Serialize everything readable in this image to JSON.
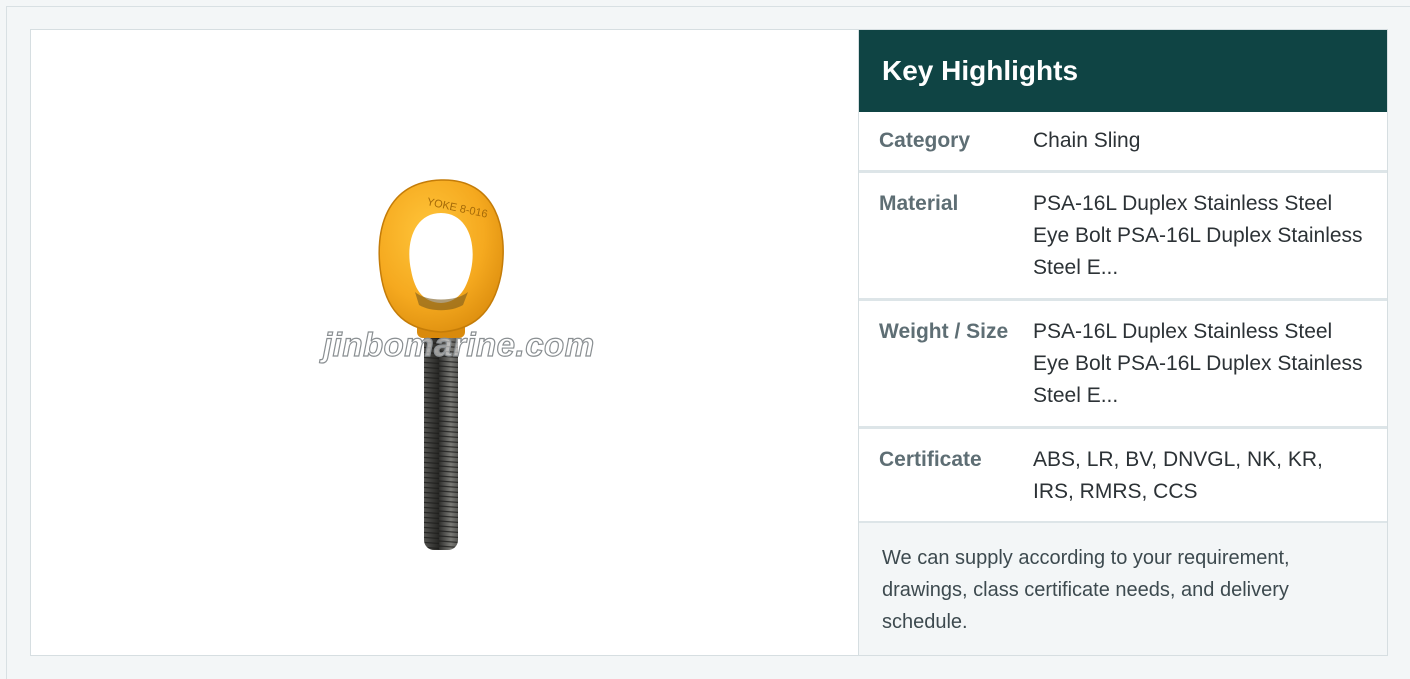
{
  "product_image": {
    "alt": "PSA-16L Duplex Stainless Steel Eye Bolt",
    "watermark": "jinbomarine.com",
    "colors": {
      "eye": "#f2a51e",
      "bolt": "#4a4a48"
    }
  },
  "specs": {
    "title": "Key Highlights",
    "rows": [
      {
        "label": "Category",
        "value": "Chain Sling"
      },
      {
        "label": "Material",
        "value": "PSA-16L Duplex Stainless Steel Eye Bolt PSA-16L Duplex Stainless Steel E..."
      },
      {
        "label": "Weight / Size",
        "value": "PSA-16L Duplex Stainless Steel Eye Bolt PSA-16L Duplex Stainless Steel E..."
      },
      {
        "label": "Certificate",
        "value": "ABS, LR, BV, DNVGL, NK, KR, IRS, RMRS, CCS"
      }
    ],
    "note": "We can supply according to your requirement, drawings, class certificate needs, and delivery schedule."
  },
  "colors": {
    "header_bg": "#0f4444",
    "page_bg": "#f3f6f7",
    "label_text": "#5e6e74"
  }
}
